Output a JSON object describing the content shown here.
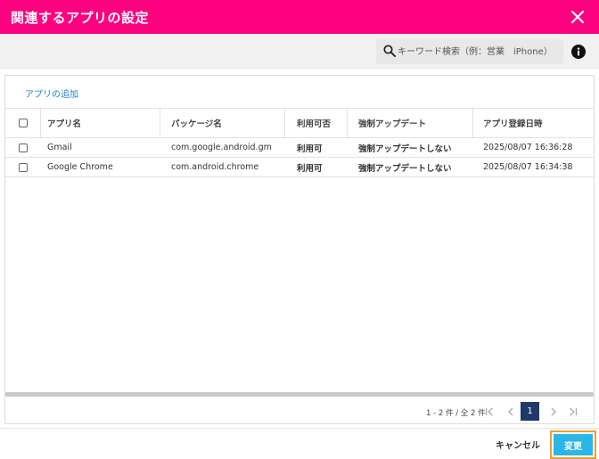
{
  "header": {
    "title": "関連するアプリの設定"
  },
  "toolbar": {
    "search_placeholder": "キーワード検索（例：営業　iPhone）"
  },
  "panel": {
    "add_app_label": "アプリの追加",
    "columns": [
      "アプリ名",
      "パッケージ名",
      "利用可否",
      "強制アップデート",
      "アプリ登録日時"
    ],
    "rows": [
      {
        "name": "Gmail",
        "package": "com.google.android.gm",
        "availability": "利用可",
        "force_update": "強制アップデートしない",
        "registered": "2025/08/07 16:36:28"
      },
      {
        "name": "Google Chrome",
        "package": "com.android.chrome",
        "availability": "利用可",
        "force_update": "強制アップデートしない",
        "registered": "2025/08/07 16:34:38"
      }
    ]
  },
  "pagination": {
    "range_text": "1 - 2 件 / 全 2 件",
    "current_page": "1"
  },
  "footer": {
    "cancel_label": "キャンセル",
    "change_label": "変更"
  },
  "colors": {
    "header": "#ff0080",
    "primary_button": "#29b6e8",
    "highlight_border": "#f0a030",
    "current_page": "#1f3a6a",
    "link": "#1e88c8"
  },
  "icons": {
    "close": "close-icon",
    "search": "search-icon",
    "info": "info-icon"
  }
}
